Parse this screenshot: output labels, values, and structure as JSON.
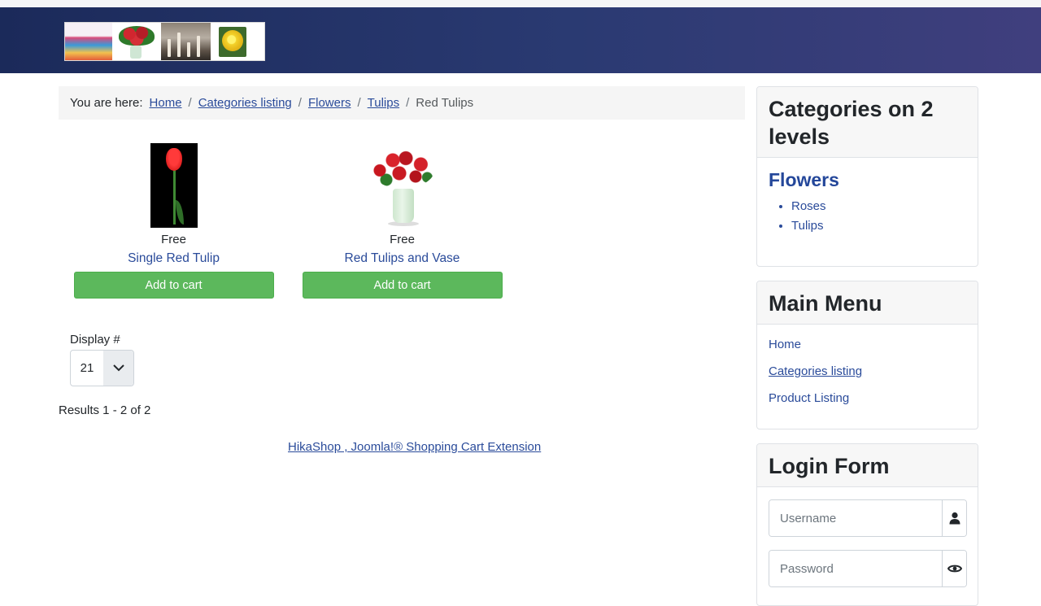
{
  "header": {
    "logo_images": [
      "gifts",
      "red-roses-bouquet",
      "candles",
      "yellow-rose"
    ]
  },
  "breadcrumb": {
    "prefix": "You are here:",
    "items": [
      {
        "label": "Home"
      },
      {
        "label": "Categories listing"
      },
      {
        "label": "Flowers"
      },
      {
        "label": "Tulips"
      }
    ],
    "current": "Red Tulips",
    "separator": "/"
  },
  "products": [
    {
      "name": "Single Red Tulip",
      "price": "Free",
      "button": "Add to cart"
    },
    {
      "name": "Red Tulips and Vase",
      "price": "Free",
      "button": "Add to cart"
    }
  ],
  "pagination": {
    "display_label": "Display #",
    "display_value": "21",
    "results": "Results 1 - 2 of 2"
  },
  "footer": {
    "link": "HikaShop , Joomla!® Shopping Cart Extension"
  },
  "sidebar": {
    "categories": {
      "title": "Categories on 2 levels",
      "parent": "Flowers",
      "children": [
        "Roses",
        "Tulips"
      ]
    },
    "main_menu": {
      "title": "Main Menu",
      "items": [
        "Home",
        "Categories listing",
        "Product Listing"
      ],
      "active_index": 1
    },
    "login": {
      "title": "Login Form",
      "username_placeholder": "Username",
      "password_placeholder": "Password"
    }
  },
  "colors": {
    "header_start": "#1b2a5a",
    "header_end": "#403f7e",
    "link": "#2a4b9a",
    "button": "#5cb85c"
  }
}
